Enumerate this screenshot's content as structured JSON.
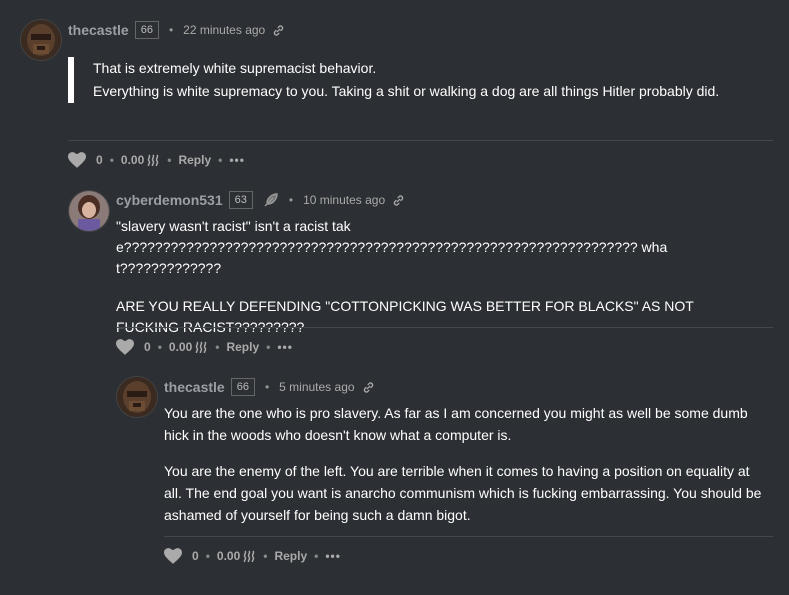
{
  "comments": [
    {
      "author": "thecastle",
      "reputation": "66",
      "time": "22 minutes ago",
      "quote_lines": [
        "That is extremely white supremacist behavior."
      ],
      "body": [
        "Everything is white supremacy to you. Taking a shit or walking a dog are all things Hitler probably did."
      ],
      "votes": "0",
      "payout": "0.00",
      "reply_label": "Reply",
      "more_label": "•••"
    },
    {
      "author": "cyberdemon531",
      "reputation": "63",
      "time": "10 minutes ago",
      "body": [
        "\"slavery wasn't racist\" isn't a racist take?????????????????????????????????????????????????????????????????? what?????????????",
        "ARE YOU REALLY DEFENDING \"COTTONPICKING WAS BETTER FOR BLACKS\" AS NOT FUCKING RACIST?????????"
      ],
      "votes": "0",
      "payout": "0.00",
      "reply_label": "Reply",
      "more_label": "•••"
    },
    {
      "author": "thecastle",
      "reputation": "66",
      "time": "5 minutes ago",
      "body": [
        "You are the one who is pro slavery. As far as I am concerned you might as well be some dumb hick in the woods who doesn't know what a computer is.",
        "You are the enemy of the left. You are terrible when it comes to having a position on equality at all. The end goal you want is anarcho communism which is fucking embarrassing. You should be ashamed of yourself for being such a damn bigot."
      ],
      "votes": "0",
      "payout": "0.00",
      "reply_label": "Reply",
      "more_label": "•••"
    }
  ],
  "icons": {
    "vote": "heart-icon",
    "link": "link-icon",
    "currency": "steem-icon",
    "badge": "feather-icon"
  },
  "colors": {
    "background": "#2c2f33",
    "author": "#9aa0a6",
    "text": "#ffffff",
    "muted": "#aaaaaa"
  }
}
